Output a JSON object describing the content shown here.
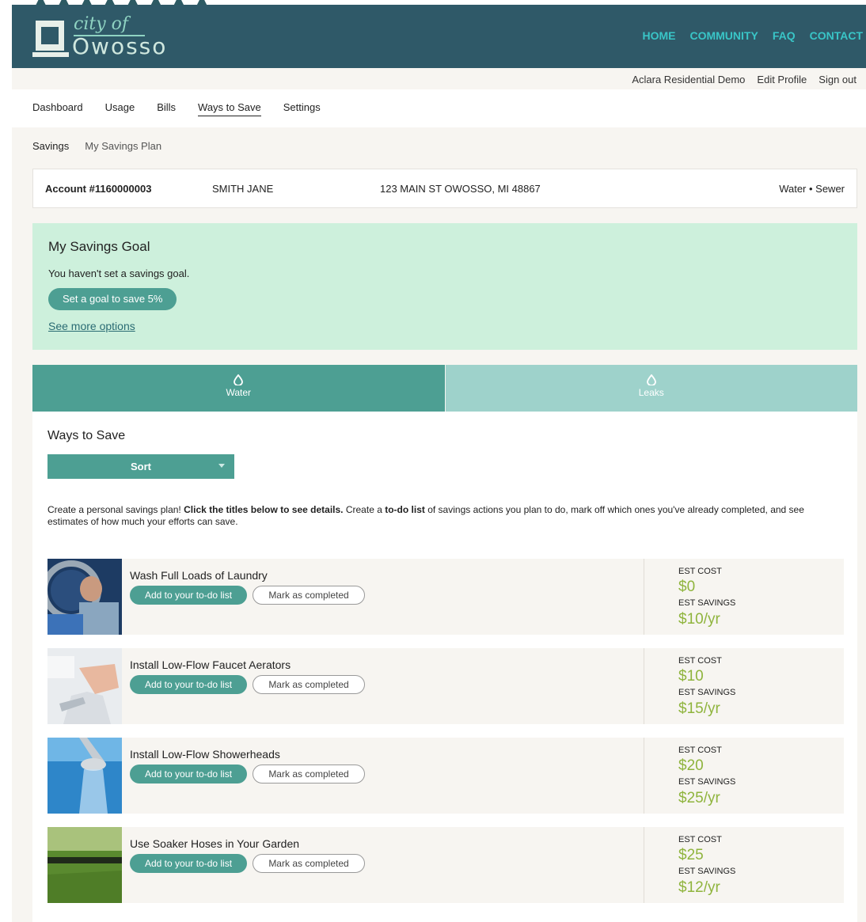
{
  "header": {
    "logo_city": "city of",
    "logo_name": "Owosso",
    "nav": [
      "HOME",
      "COMMUNITY",
      "FAQ",
      "CONTACT"
    ]
  },
  "userbar": {
    "account_name": "Aclara Residential Demo",
    "edit_profile": "Edit Profile",
    "sign_out": "Sign out"
  },
  "mainnav": {
    "items": [
      "Dashboard",
      "Usage",
      "Bills",
      "Ways to Save",
      "Settings"
    ],
    "active": "Ways to Save"
  },
  "subnav": {
    "items": [
      "Savings",
      "My Savings Plan"
    ]
  },
  "account": {
    "number": "Account #1160000003",
    "name": "SMITH JANE",
    "address": "123 MAIN ST OWOSSO, MI 48867",
    "services": "Water • Sewer"
  },
  "goal": {
    "title": "My Savings Goal",
    "message": "You haven't set a savings goal.",
    "button": "Set a goal to save 5%",
    "more_link": "See more options"
  },
  "tabs": [
    "Water",
    "Leaks"
  ],
  "ways": {
    "title": "Ways to Save",
    "sort_label": "Sort",
    "intro_1": "Create a personal savings plan! ",
    "intro_bold_1": "Click the titles below to see details.",
    "intro_2": " Create a ",
    "intro_bold_2": "to-do list",
    "intro_3": " of savings actions you plan to do, mark off which ones you've already completed, and see estimates of how much your efforts can save.",
    "todo_label": "Add to your to-do list",
    "done_label": "Mark as completed",
    "cost_label": "EST COST",
    "savings_label": "EST SAVINGS",
    "items": [
      {
        "title": "Wash Full Loads of Laundry",
        "cost": "$0",
        "savings": "$10/yr"
      },
      {
        "title": "Install Low-Flow Faucet Aerators",
        "cost": "$10",
        "savings": "$15/yr"
      },
      {
        "title": "Install Low-Flow Showerheads",
        "cost": "$20",
        "savings": "$25/yr"
      },
      {
        "title": "Use Soaker Hoses in Your Garden",
        "cost": "$25",
        "savings": "$12/yr"
      }
    ]
  },
  "colors": {
    "header_bg": "#2f5968",
    "nav_link": "#39c5c7",
    "accent": "#4d9f93",
    "goal_bg": "#cdf0dc",
    "price": "#8fb43d"
  }
}
